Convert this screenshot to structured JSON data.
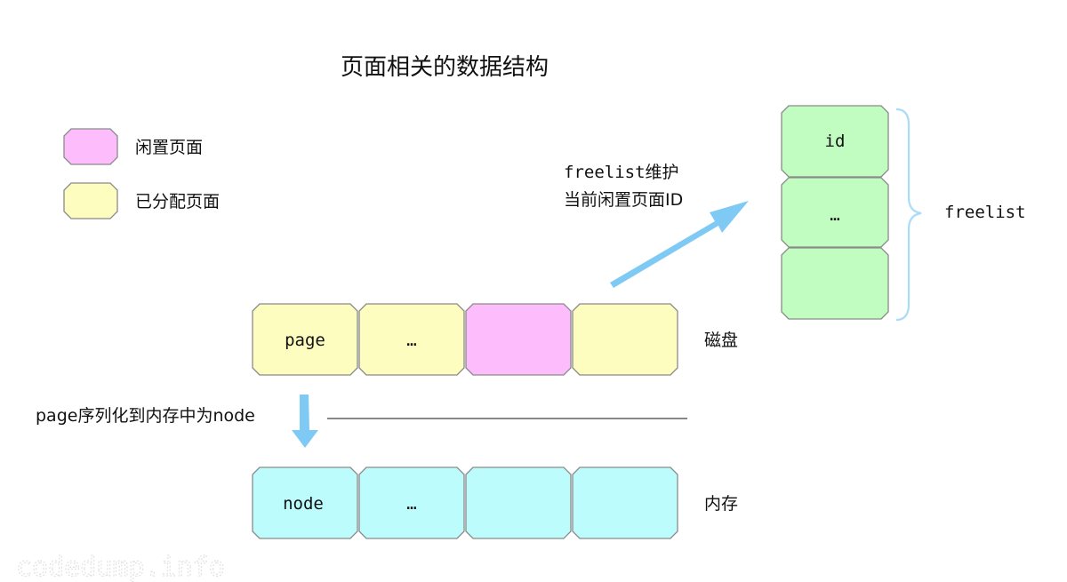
{
  "title": "页面相关的数据结构",
  "colors": {
    "free_page": "#fdbcfb",
    "allocated_page": "#fdfdbf",
    "freelist_cell": "#c1fdc1",
    "memory_node": "#bdfcfd",
    "arrow": "#7fcaf5",
    "brace": "#a9dcf8"
  },
  "legend": [
    {
      "label": "闲置页面",
      "color_key": "free_page"
    },
    {
      "label": "已分配页面",
      "color_key": "allocated_page"
    }
  ],
  "disk": {
    "label": "磁盘",
    "cells": [
      {
        "text": "page",
        "color_key": "allocated_page"
      },
      {
        "text": "…",
        "color_key": "allocated_page"
      },
      {
        "text": "",
        "color_key": "free_page"
      },
      {
        "text": "",
        "color_key": "allocated_page"
      }
    ]
  },
  "memory": {
    "label": "内存",
    "cells": [
      {
        "text": "node",
        "color_key": "memory_node"
      },
      {
        "text": "…",
        "color_key": "memory_node"
      },
      {
        "text": "",
        "color_key": "memory_node"
      },
      {
        "text": "",
        "color_key": "memory_node"
      }
    ]
  },
  "freelist": {
    "label": "freelist",
    "cells": [
      {
        "text": "id"
      },
      {
        "text": "…"
      },
      {
        "text": ""
      }
    ],
    "annotation_line1": "freelist维护",
    "annotation_line2": "当前闲置页面ID"
  },
  "serialize_label": "page序列化到内存中为node",
  "watermark": "codedump.info"
}
